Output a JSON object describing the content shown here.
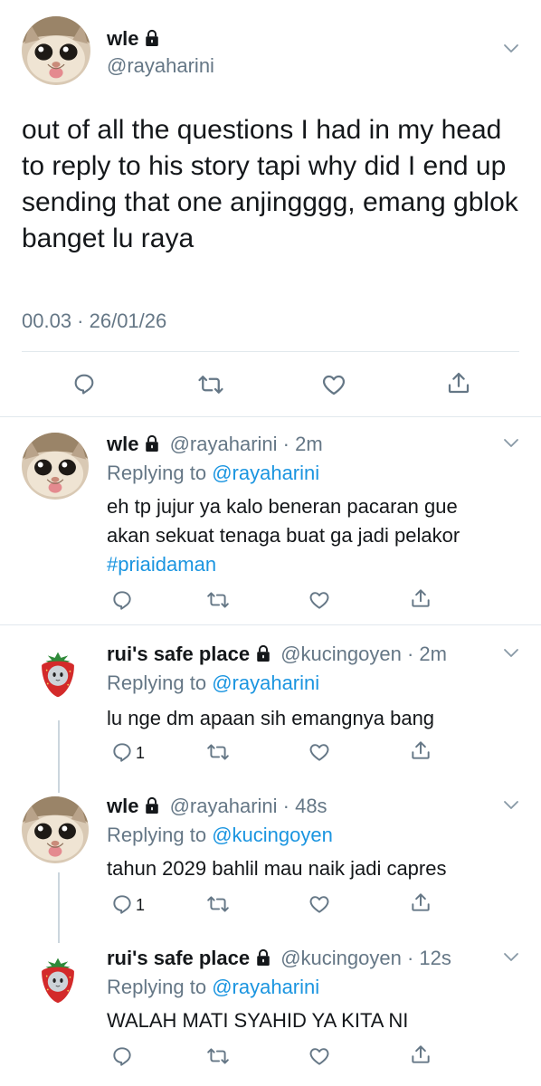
{
  "main_tweet": {
    "name": "wle",
    "handle": "@rayaharini",
    "text": "out of all the questions I had in my head to reply to his story tapi why did I end up sending that one anjingggg, emang gblok banget lu raya",
    "timestamp": "00.03 · 26/01/26"
  },
  "replies": [
    {
      "name": "wle",
      "handle_time": "@rayaharini · 2m",
      "replying_prefix": "Replying to",
      "replying_to": "@rayaharini",
      "text": "eh tp jujur ya kalo beneran pacaran gue akan sekuat tenaga buat ga jadi pelakor",
      "hashtag": "#priaidaman",
      "reply_count": ""
    },
    {
      "name": "rui's safe place",
      "handle_time": "@kucingoyen · 2m",
      "replying_prefix": "Replying to",
      "replying_to": "@rayaharini",
      "text": "lu nge dm apaan sih emangnya bang",
      "reply_count": "1"
    },
    {
      "name": "wle",
      "handle_time": "@rayaharini · 48s",
      "replying_prefix": "Replying to",
      "replying_to": "@kucingoyen",
      "text": "tahun 2029 bahlil mau naik jadi capres",
      "reply_count": "1"
    },
    {
      "name": "rui's safe place",
      "handle_time": "@kucingoyen · 12s",
      "replying_prefix": "Replying to",
      "replying_to": "@rayaharini",
      "text": "WALAH MATI SYAHID YA KITA NI",
      "reply_count": ""
    }
  ],
  "icons": [
    "chevron-down-icon",
    "lock-icon",
    "reply-icon",
    "retweet-icon",
    "like-icon",
    "share-icon"
  ],
  "colors": {
    "link": "#1b95e0",
    "muted": "#657786",
    "divider": "#e1e8ed",
    "text": "#14171a"
  }
}
